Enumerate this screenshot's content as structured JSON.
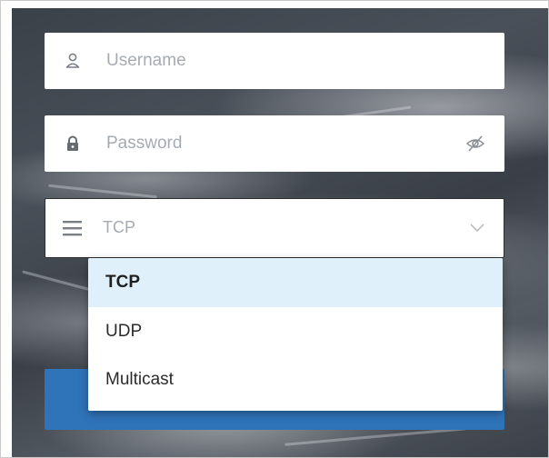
{
  "login_form": {
    "username": {
      "placeholder": "Username",
      "icon": "user-icon"
    },
    "password": {
      "placeholder": "Password",
      "icon": "lock-icon",
      "toggle_icon": "eye-slash-icon"
    },
    "protocol_select": {
      "selected": "TCP",
      "icon": "menu-icon",
      "chevron_icon": "chevron-down-icon",
      "options": [
        "TCP",
        "UDP",
        "Multicast"
      ],
      "highlighted_option": "TCP"
    },
    "login_button": {
      "label": ""
    }
  },
  "colors": {
    "primary_button": "#2f73b8",
    "selected_option_bg": "#dff0fa",
    "placeholder_text": "#a6abb2"
  }
}
